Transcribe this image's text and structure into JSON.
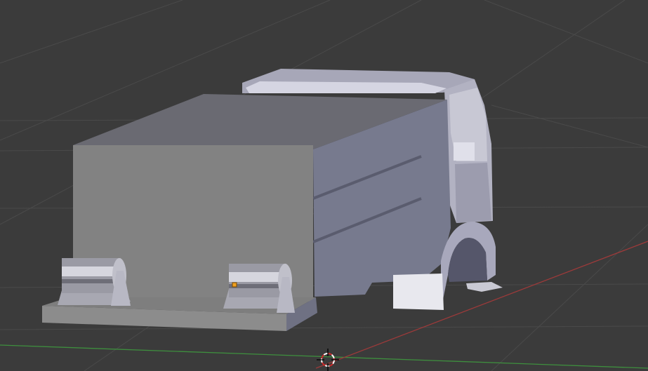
{
  "app": {
    "name": "3D viewport",
    "view": "perspective"
  },
  "viewport": {
    "label": "",
    "background_color": "#3b3b3b",
    "grid": true,
    "grid_color": "#4a4a4a",
    "x_axis_color": "#9c3a3a",
    "y_axis_color": "#3e8f3e",
    "cursor_colors": {
      "ring_a": "#ffffff",
      "ring_b": "#cc2a2a"
    }
  },
  "scene": {
    "object": "truck",
    "parts": [
      "cargo-box",
      "rear-platform",
      "cylinder-left",
      "cylinder-right",
      "cab",
      "wheel-arch",
      "step-plate"
    ],
    "selected_point_color": "#f0a020"
  },
  "icons": {
    "cursor": "3d-cursor-icon"
  }
}
